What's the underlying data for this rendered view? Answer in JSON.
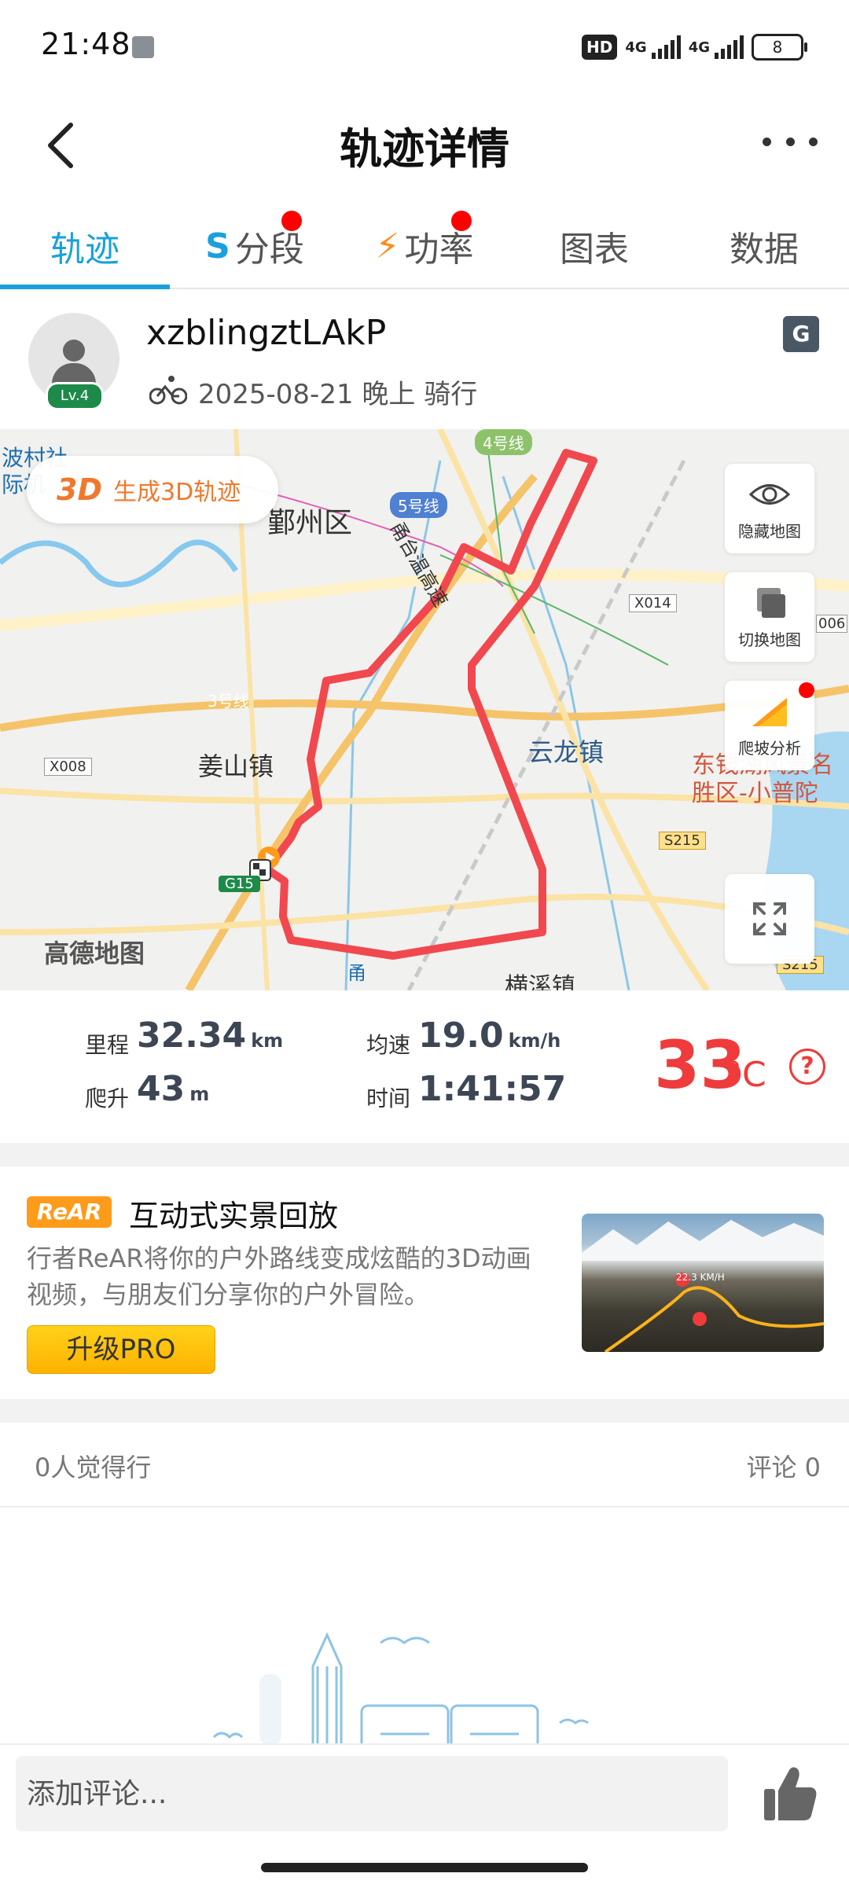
{
  "status_bar": {
    "time": "21:48",
    "hd_label": "HD",
    "network_1": "4G",
    "network_2": "4G",
    "battery": "8"
  },
  "header": {
    "title": "轨迹详情"
  },
  "tabs": [
    {
      "label": "轨迹",
      "active": true,
      "dot": false
    },
    {
      "label": "分段",
      "active": false,
      "dot": true,
      "icon": "segment-icon"
    },
    {
      "label": "功率",
      "active": false,
      "dot": true,
      "icon": "lightning-icon"
    },
    {
      "label": "图表",
      "active": false,
      "dot": false
    },
    {
      "label": "数据",
      "active": false,
      "dot": false
    }
  ],
  "profile": {
    "username": "xzblingztLAkP",
    "level": "Lv.4",
    "ride_meta": "2025-08-21 晚上 骑行"
  },
  "map": {
    "generate_3d_tag": "3D",
    "generate_3d_label": "生成3D轨迹",
    "tools": [
      "隐藏地图",
      "切换地图",
      "爬坡分析"
    ],
    "labels": {
      "district": "鄞州区",
      "line4": "4号线",
      "line5": "5号线",
      "line3": "3号线",
      "jiangshan": "姜山镇",
      "yunlong": "云龙镇",
      "hengxi": "横溪镇",
      "x008": "X008",
      "x014": "X014",
      "x006": "006",
      "s215a": "S215",
      "s215b": "S215",
      "g15": "G15",
      "road": "甬台温高速",
      "dongqian": "东钱湖风景名胜区-小普陀",
      "top_left": "波村社际机",
      "brand": "高德地图",
      "bottom_road": "甬新"
    },
    "route_color": "#f0484e"
  },
  "stats": {
    "distance_label": "里程",
    "distance_value": "32.34",
    "distance_unit": "km",
    "avg_speed_label": "均速",
    "avg_speed_value": "19.0",
    "avg_speed_unit": "km/h",
    "climb_label": "爬升",
    "climb_value": "43",
    "climb_unit": "m",
    "time_label": "时间",
    "time_value": "1:41:57",
    "temperature": "33",
    "temperature_unit": "°C"
  },
  "promo": {
    "logo": "ReAR",
    "title": "互动式实景回放",
    "description": "行者ReAR将你的户外路线变成炫酷的3D动画视频，与朋友们分享你的户外冒险。",
    "button": "升级PRO",
    "thumb_speed": "22.3 KM/H"
  },
  "social": {
    "likes": "0人觉得行",
    "comments": "评论 0"
  },
  "comment_bar": {
    "placeholder": "添加评论..."
  }
}
